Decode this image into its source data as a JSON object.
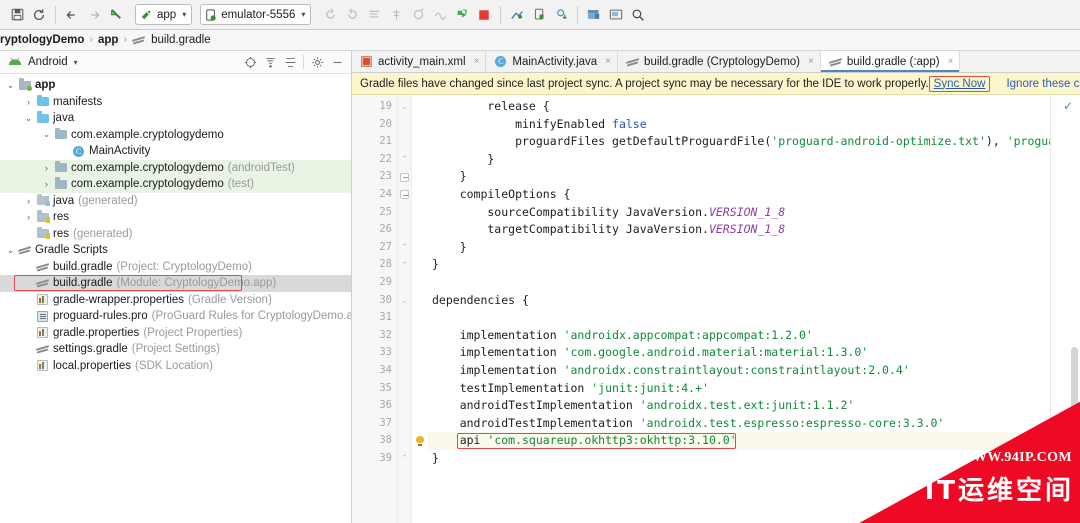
{
  "toolbar": {
    "buttons": [
      {
        "name": "save-all-button",
        "glyph": "⛃"
      },
      {
        "name": "sync-project-button",
        "glyph": "↻"
      },
      {
        "name": "nav-back-button",
        "glyph": "←"
      },
      {
        "name": "nav-forward-button",
        "glyph": "→"
      },
      {
        "name": "undo-button",
        "glyph": "↖"
      }
    ],
    "run_config": {
      "label": "app",
      "caret": "▾"
    },
    "device": {
      "label": "emulator-5556",
      "caret": "▾"
    },
    "right_buttons": [
      {
        "name": "sync-gradle-icon",
        "glyph": "↻"
      },
      {
        "name": "avd-manager-icon",
        "glyph": "↺"
      },
      {
        "name": "sdk-manager-icon",
        "glyph": "☰"
      },
      {
        "name": "profiler-icon",
        "glyph": "⚗"
      },
      {
        "name": "attach-debugger-icon",
        "glyph": "◔"
      },
      {
        "name": "layout-inspector-icon",
        "glyph": "∿"
      },
      {
        "name": "run-button",
        "glyph": "▶"
      },
      {
        "name": "stop-button",
        "glyph": "■"
      },
      {
        "name": "device-file-explorer-icon",
        "glyph": "⚒"
      },
      {
        "name": "device-manager-icon",
        "glyph": "⬚"
      },
      {
        "name": "sdk-download-icon",
        "glyph": "⬇"
      },
      {
        "name": "project-structure-icon",
        "glyph": "☷"
      },
      {
        "name": "terminal-icon",
        "glyph": "▭"
      },
      {
        "name": "search-everywhere-icon",
        "glyph": "⚲"
      }
    ]
  },
  "breadcrumb": {
    "items": [
      "ryptologyDemo",
      "app",
      "build.gradle"
    ],
    "separator": "›"
  },
  "project_panel": {
    "title": "Android",
    "title_caret": "▾",
    "toolbar_icons": [
      {
        "name": "select-opened-file-icon",
        "glyph": "⊕"
      },
      {
        "name": "expand-all-icon",
        "glyph": "≡"
      },
      {
        "name": "collapse-all-icon",
        "glyph": "−"
      },
      {
        "name": "settings-gear-icon",
        "glyph": "⚙"
      },
      {
        "name": "hide-panel-icon",
        "glyph": "−"
      }
    ],
    "tree": [
      {
        "indent": 0,
        "twist": "⌄",
        "icon": "folder-app",
        "label": "app",
        "bold": true,
        "dim": "",
        "state": "normal"
      },
      {
        "indent": 1,
        "twist": "›",
        "icon": "folder-blue",
        "label": "manifests",
        "bold": false,
        "dim": "",
        "state": "normal"
      },
      {
        "indent": 1,
        "twist": "⌄",
        "icon": "folder-blue",
        "label": "java",
        "bold": false,
        "dim": "",
        "state": "normal"
      },
      {
        "indent": 2,
        "twist": "⌄",
        "icon": "folder-grey",
        "label": "com.example.cryptologydemo",
        "bold": false,
        "dim": "",
        "state": "normal"
      },
      {
        "indent": 3,
        "twist": "",
        "icon": "c-badge",
        "label": "MainActivity",
        "bold": false,
        "dim": "",
        "state": "normal"
      },
      {
        "indent": 2,
        "twist": "›",
        "icon": "folder-grey",
        "label": "com.example.cryptologydemo",
        "bold": false,
        "dim": "(androidTest)",
        "state": "green"
      },
      {
        "indent": 2,
        "twist": "›",
        "icon": "folder-grey",
        "label": "com.example.cryptologydemo",
        "bold": false,
        "dim": "(test)",
        "state": "green"
      },
      {
        "indent": 1,
        "twist": "›",
        "icon": "folder-gen",
        "label": "java",
        "bold": false,
        "dim": "(generated)",
        "state": "normal"
      },
      {
        "indent": 1,
        "twist": "›",
        "icon": "folder-res",
        "label": "res",
        "bold": false,
        "dim": "",
        "state": "normal"
      },
      {
        "indent": 1,
        "twist": "",
        "icon": "folder-res",
        "label": "res",
        "bold": false,
        "dim": "(generated)",
        "state": "normal"
      },
      {
        "indent": 0,
        "twist": "⌄",
        "icon": "gradle-ic",
        "label": "Gradle Scripts",
        "bold": false,
        "dim": "",
        "state": "normal"
      },
      {
        "indent": 1,
        "twist": "",
        "icon": "gradle-ic",
        "label": "build.gradle",
        "bold": false,
        "dim": "(Project: CryptologyDemo)",
        "state": "normal"
      },
      {
        "indent": 1,
        "twist": "",
        "icon": "gradle-ic",
        "label": "build.gradle",
        "bold": false,
        "dim": "(Module: CryptologyDemo.app)",
        "state": "selected"
      },
      {
        "indent": 1,
        "twist": "",
        "icon": "props-ic",
        "label": "gradle-wrapper.properties",
        "bold": false,
        "dim": "(Gradle Version)",
        "state": "normal"
      },
      {
        "indent": 1,
        "twist": "",
        "icon": "pg-ic",
        "label": "proguard-rules.pro",
        "bold": false,
        "dim": "(ProGuard Rules for CryptologyDemo.app)",
        "state": "normal"
      },
      {
        "indent": 1,
        "twist": "",
        "icon": "props-ic",
        "label": "gradle.properties",
        "bold": false,
        "dim": "(Project Properties)",
        "state": "normal"
      },
      {
        "indent": 1,
        "twist": "",
        "icon": "settings-ic",
        "label": "settings.gradle",
        "bold": false,
        "dim": "(Project Settings)",
        "state": "normal"
      },
      {
        "indent": 1,
        "twist": "",
        "icon": "props-ic",
        "label": "local.properties",
        "bold": false,
        "dim": "(SDK Location)",
        "state": "normal"
      }
    ]
  },
  "editor": {
    "tabs": [
      {
        "label": "activity_main.xml",
        "icon": "xml-file-icon",
        "active": false,
        "close": "×"
      },
      {
        "label": "MainActivity.java",
        "icon": "java-class-icon",
        "active": false,
        "close": "×"
      },
      {
        "label": "build.gradle (CryptologyDemo)",
        "icon": "gradle-file-icon",
        "active": false,
        "close": "×"
      },
      {
        "label": "build.gradle (:app)",
        "icon": "gradle-file-icon",
        "active": true,
        "close": "×"
      }
    ],
    "notification": {
      "message": "Gradle files have changed since last project sync. A project sync may be necessary for the IDE to work properly.",
      "sync_label": "Sync Now",
      "ignore_label": "Ignore these changes"
    },
    "first_line_number": 19,
    "lines": [
      {
        "n": 19,
        "fold": "arrow-dn",
        "text": "        release {"
      },
      {
        "n": 20,
        "fold": "",
        "text": "            minifyEnabled false"
      },
      {
        "n": 21,
        "fold": "",
        "text": "            proguardFiles getDefaultProguardFile('proguard-android-optimize.txt'), 'proguard-rules.pro'"
      },
      {
        "n": 22,
        "fold": "arrow-up",
        "text": "        }"
      },
      {
        "n": 23,
        "fold": "minus",
        "text": "    }"
      },
      {
        "n": 24,
        "fold": "minus",
        "text": "    compileOptions {"
      },
      {
        "n": 25,
        "fold": "",
        "text": "        sourceCompatibility JavaVersion.VERSION_1_8"
      },
      {
        "n": 26,
        "fold": "",
        "text": "        targetCompatibility JavaVersion.VERSION_1_8"
      },
      {
        "n": 27,
        "fold": "arrow-up",
        "text": "    }"
      },
      {
        "n": 28,
        "fold": "arrow-up",
        "text": "}"
      },
      {
        "n": 29,
        "fold": "",
        "text": ""
      },
      {
        "n": 30,
        "fold": "arrow-dn",
        "text": "dependencies {"
      },
      {
        "n": 31,
        "fold": "",
        "text": ""
      },
      {
        "n": 32,
        "fold": "",
        "text": "    implementation 'androidx.appcompat:appcompat:1.2.0'"
      },
      {
        "n": 33,
        "fold": "",
        "text": "    implementation 'com.google.android.material:material:1.3.0'"
      },
      {
        "n": 34,
        "fold": "",
        "text": "    implementation 'androidx.constraintlayout:constraintlayout:2.0.4'"
      },
      {
        "n": 35,
        "fold": "",
        "text": "    testImplementation 'junit:junit:4.+'"
      },
      {
        "n": 36,
        "fold": "",
        "text": "    androidTestImplementation 'androidx.test.ext:junit:1.1.2'"
      },
      {
        "n": 37,
        "fold": "",
        "text": "    androidTestImplementation 'androidx.test.espresso:espresso-core:3.3.0'"
      },
      {
        "n": 38,
        "fold": "",
        "text": "    api 'com.squareup.okhttp3:okhttp:3.10.0'"
      },
      {
        "n": 39,
        "fold": "arrow-up",
        "text": "}"
      }
    ],
    "highlighted_line": 38,
    "inspection_status": "✓"
  },
  "watermark": {
    "url": "WWW.94IP.COM",
    "brand": "IT运维空间",
    "color": "#ee0a24"
  },
  "colors": {
    "accent": "#4a88c7",
    "highlight_box": "#e04a4a",
    "notification_bg": "#fdf6cd",
    "string_green": "#108a3a",
    "keyword_blue": "#2a4fd6",
    "static_purple": "#8a3fa8",
    "tree_green": "#eaf4e5"
  }
}
